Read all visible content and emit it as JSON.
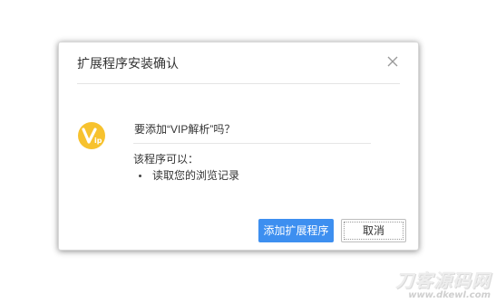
{
  "dialog": {
    "title": "扩展程序安装确认",
    "question": "要添加“VIP解析”吗？",
    "permissions_heading": "该程序可以：",
    "permissions": [
      "读取您的浏览记录"
    ],
    "confirm_label": "添加扩展程序",
    "cancel_label": "取消",
    "icon_text": "ip"
  },
  "icons": {
    "close": "close-icon",
    "extension": "vip-extension-icon"
  },
  "colors": {
    "primary_button": "#3d8ff0",
    "extension_icon": "#f7c22e"
  },
  "watermark": {
    "text": "刀客源码网",
    "url": "www.dkewl.com"
  }
}
